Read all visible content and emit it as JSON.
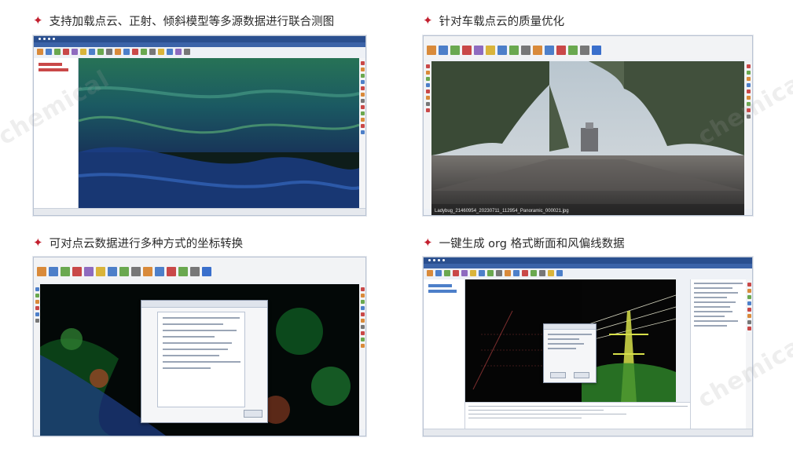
{
  "captions": {
    "top_left": "支持加载点云、正射、倾斜模型等多源数据进行联合测图",
    "top_right": "针对车载点云的质量优化",
    "bottom_left": "可对点云数据进行多种方式的坐标转换",
    "bottom_right": "一键生成 org 格式断面和风偏线数据"
  },
  "bullet_icon": "four-point-star-icon",
  "panorama_filename": "Ladybug_21460954_20230711_112954_Panoramic_000021.jpg",
  "watermark_text": "chemical"
}
